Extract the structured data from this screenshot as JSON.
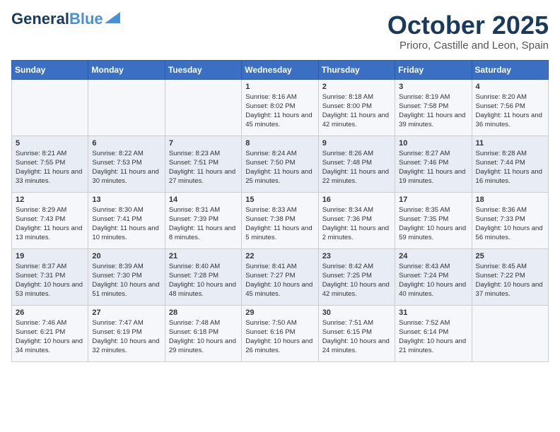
{
  "header": {
    "logo_general": "General",
    "logo_blue": "Blue",
    "month_title": "October 2025",
    "location": "Prioro, Castille and Leon, Spain"
  },
  "weekdays": [
    "Sunday",
    "Monday",
    "Tuesday",
    "Wednesday",
    "Thursday",
    "Friday",
    "Saturday"
  ],
  "weeks": [
    [
      {
        "day": "",
        "sunrise": "",
        "sunset": "",
        "daylight": ""
      },
      {
        "day": "",
        "sunrise": "",
        "sunset": "",
        "daylight": ""
      },
      {
        "day": "",
        "sunrise": "",
        "sunset": "",
        "daylight": ""
      },
      {
        "day": "1",
        "sunrise": "Sunrise: 8:16 AM",
        "sunset": "Sunset: 8:02 PM",
        "daylight": "Daylight: 11 hours and 45 minutes."
      },
      {
        "day": "2",
        "sunrise": "Sunrise: 8:18 AM",
        "sunset": "Sunset: 8:00 PM",
        "daylight": "Daylight: 11 hours and 42 minutes."
      },
      {
        "day": "3",
        "sunrise": "Sunrise: 8:19 AM",
        "sunset": "Sunset: 7:58 PM",
        "daylight": "Daylight: 11 hours and 39 minutes."
      },
      {
        "day": "4",
        "sunrise": "Sunrise: 8:20 AM",
        "sunset": "Sunset: 7:56 PM",
        "daylight": "Daylight: 11 hours and 36 minutes."
      }
    ],
    [
      {
        "day": "5",
        "sunrise": "Sunrise: 8:21 AM",
        "sunset": "Sunset: 7:55 PM",
        "daylight": "Daylight: 11 hours and 33 minutes."
      },
      {
        "day": "6",
        "sunrise": "Sunrise: 8:22 AM",
        "sunset": "Sunset: 7:53 PM",
        "daylight": "Daylight: 11 hours and 30 minutes."
      },
      {
        "day": "7",
        "sunrise": "Sunrise: 8:23 AM",
        "sunset": "Sunset: 7:51 PM",
        "daylight": "Daylight: 11 hours and 27 minutes."
      },
      {
        "day": "8",
        "sunrise": "Sunrise: 8:24 AM",
        "sunset": "Sunset: 7:50 PM",
        "daylight": "Daylight: 11 hours and 25 minutes."
      },
      {
        "day": "9",
        "sunrise": "Sunrise: 8:26 AM",
        "sunset": "Sunset: 7:48 PM",
        "daylight": "Daylight: 11 hours and 22 minutes."
      },
      {
        "day": "10",
        "sunrise": "Sunrise: 8:27 AM",
        "sunset": "Sunset: 7:46 PM",
        "daylight": "Daylight: 11 hours and 19 minutes."
      },
      {
        "day": "11",
        "sunrise": "Sunrise: 8:28 AM",
        "sunset": "Sunset: 7:44 PM",
        "daylight": "Daylight: 11 hours and 16 minutes."
      }
    ],
    [
      {
        "day": "12",
        "sunrise": "Sunrise: 8:29 AM",
        "sunset": "Sunset: 7:43 PM",
        "daylight": "Daylight: 11 hours and 13 minutes."
      },
      {
        "day": "13",
        "sunrise": "Sunrise: 8:30 AM",
        "sunset": "Sunset: 7:41 PM",
        "daylight": "Daylight: 11 hours and 10 minutes."
      },
      {
        "day": "14",
        "sunrise": "Sunrise: 8:31 AM",
        "sunset": "Sunset: 7:39 PM",
        "daylight": "Daylight: 11 hours and 8 minutes."
      },
      {
        "day": "15",
        "sunrise": "Sunrise: 8:33 AM",
        "sunset": "Sunset: 7:38 PM",
        "daylight": "Daylight: 11 hours and 5 minutes."
      },
      {
        "day": "16",
        "sunrise": "Sunrise: 8:34 AM",
        "sunset": "Sunset: 7:36 PM",
        "daylight": "Daylight: 11 hours and 2 minutes."
      },
      {
        "day": "17",
        "sunrise": "Sunrise: 8:35 AM",
        "sunset": "Sunset: 7:35 PM",
        "daylight": "Daylight: 10 hours and 59 minutes."
      },
      {
        "day": "18",
        "sunrise": "Sunrise: 8:36 AM",
        "sunset": "Sunset: 7:33 PM",
        "daylight": "Daylight: 10 hours and 56 minutes."
      }
    ],
    [
      {
        "day": "19",
        "sunrise": "Sunrise: 8:37 AM",
        "sunset": "Sunset: 7:31 PM",
        "daylight": "Daylight: 10 hours and 53 minutes."
      },
      {
        "day": "20",
        "sunrise": "Sunrise: 8:39 AM",
        "sunset": "Sunset: 7:30 PM",
        "daylight": "Daylight: 10 hours and 51 minutes."
      },
      {
        "day": "21",
        "sunrise": "Sunrise: 8:40 AM",
        "sunset": "Sunset: 7:28 PM",
        "daylight": "Daylight: 10 hours and 48 minutes."
      },
      {
        "day": "22",
        "sunrise": "Sunrise: 8:41 AM",
        "sunset": "Sunset: 7:27 PM",
        "daylight": "Daylight: 10 hours and 45 minutes."
      },
      {
        "day": "23",
        "sunrise": "Sunrise: 8:42 AM",
        "sunset": "Sunset: 7:25 PM",
        "daylight": "Daylight: 10 hours and 42 minutes."
      },
      {
        "day": "24",
        "sunrise": "Sunrise: 8:43 AM",
        "sunset": "Sunset: 7:24 PM",
        "daylight": "Daylight: 10 hours and 40 minutes."
      },
      {
        "day": "25",
        "sunrise": "Sunrise: 8:45 AM",
        "sunset": "Sunset: 7:22 PM",
        "daylight": "Daylight: 10 hours and 37 minutes."
      }
    ],
    [
      {
        "day": "26",
        "sunrise": "Sunrise: 7:46 AM",
        "sunset": "Sunset: 6:21 PM",
        "daylight": "Daylight: 10 hours and 34 minutes."
      },
      {
        "day": "27",
        "sunrise": "Sunrise: 7:47 AM",
        "sunset": "Sunset: 6:19 PM",
        "daylight": "Daylight: 10 hours and 32 minutes."
      },
      {
        "day": "28",
        "sunrise": "Sunrise: 7:48 AM",
        "sunset": "Sunset: 6:18 PM",
        "daylight": "Daylight: 10 hours and 29 minutes."
      },
      {
        "day": "29",
        "sunrise": "Sunrise: 7:50 AM",
        "sunset": "Sunset: 6:16 PM",
        "daylight": "Daylight: 10 hours and 26 minutes."
      },
      {
        "day": "30",
        "sunrise": "Sunrise: 7:51 AM",
        "sunset": "Sunset: 6:15 PM",
        "daylight": "Daylight: 10 hours and 24 minutes."
      },
      {
        "day": "31",
        "sunrise": "Sunrise: 7:52 AM",
        "sunset": "Sunset: 6:14 PM",
        "daylight": "Daylight: 10 hours and 21 minutes."
      },
      {
        "day": "",
        "sunrise": "",
        "sunset": "",
        "daylight": ""
      }
    ]
  ]
}
